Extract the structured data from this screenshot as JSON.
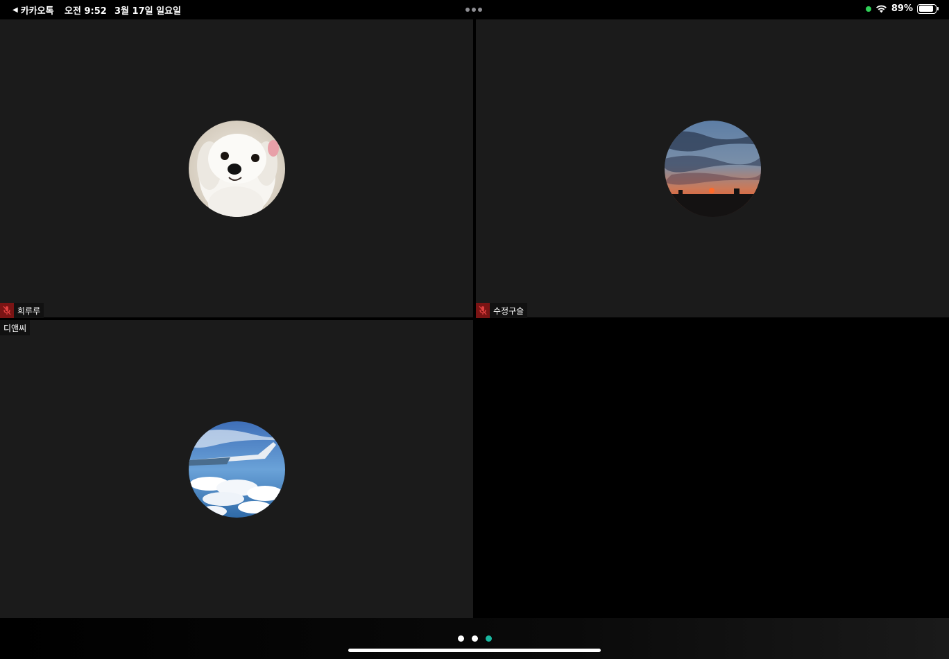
{
  "status_bar": {
    "back_app": "카카오톡",
    "time": "오전 9:52",
    "date": "3월 17일 일요일",
    "battery_percent": "89%",
    "battery_level": 0.89
  },
  "participants": [
    {
      "name": "희루루",
      "muted": true,
      "avatar": "dog-photo"
    },
    {
      "name": "수정구슬",
      "muted": true,
      "avatar": "sunset-photo"
    },
    {
      "name": "디앤씨",
      "muted": false,
      "avatar": "airplane-sky-photo"
    }
  ],
  "page_indicator": {
    "total": 3,
    "current": 3
  },
  "colors": {
    "tile_background": "#1b1b1b",
    "mute_badge": "#7a1414",
    "active_page_dot": "#19b8a0",
    "inactive_page_dot": "#ffffff",
    "status_dot": "#30d158"
  }
}
